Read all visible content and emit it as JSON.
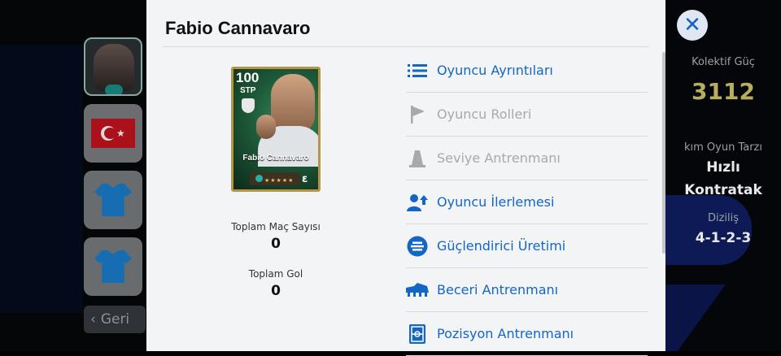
{
  "player": {
    "name": "Fabio Cannavaro",
    "card": {
      "rating": "100",
      "position": "STP",
      "name": "Fabio Cannavaro"
    },
    "stats": [
      {
        "label": "Toplam Maç Sayısı",
        "value": "0"
      },
      {
        "label": "Toplam Gol",
        "value": "0"
      }
    ]
  },
  "menu": [
    {
      "label": "Oyuncu Ayrıntıları",
      "icon": "list-icon",
      "enabled": true
    },
    {
      "label": "Oyuncu Rolleri",
      "icon": "flag-icon",
      "enabled": false
    },
    {
      "label": "Seviye Antrenmanı",
      "icon": "cone-icon",
      "enabled": false
    },
    {
      "label": "Oyuncu İlerlemesi",
      "icon": "person-up-icon",
      "enabled": true
    },
    {
      "label": "Güçlendirici Üretimi",
      "icon": "booster-icon",
      "enabled": true
    },
    {
      "label": "Beceri Antrenmanı",
      "icon": "cleat-icon",
      "enabled": true
    },
    {
      "label": "Pozisyon Antrenmanı",
      "icon": "pitch-icon",
      "enabled": true
    }
  ],
  "background": {
    "back_label": "Geri",
    "collective_power_label": "Kolektif Güç",
    "collective_power_value": "3112",
    "team_style_label": "kım Oyun Tarzı",
    "team_style_line1": "Hızlı",
    "team_style_line2": "Kontratak",
    "formation_label": "Diziliş",
    "formation_value": "4-1-2-3"
  },
  "colors": {
    "accent": "#1466c4",
    "disabled": "#a7a9ab",
    "card_gold": "#b89545",
    "power_gold": "#b8ae60"
  }
}
